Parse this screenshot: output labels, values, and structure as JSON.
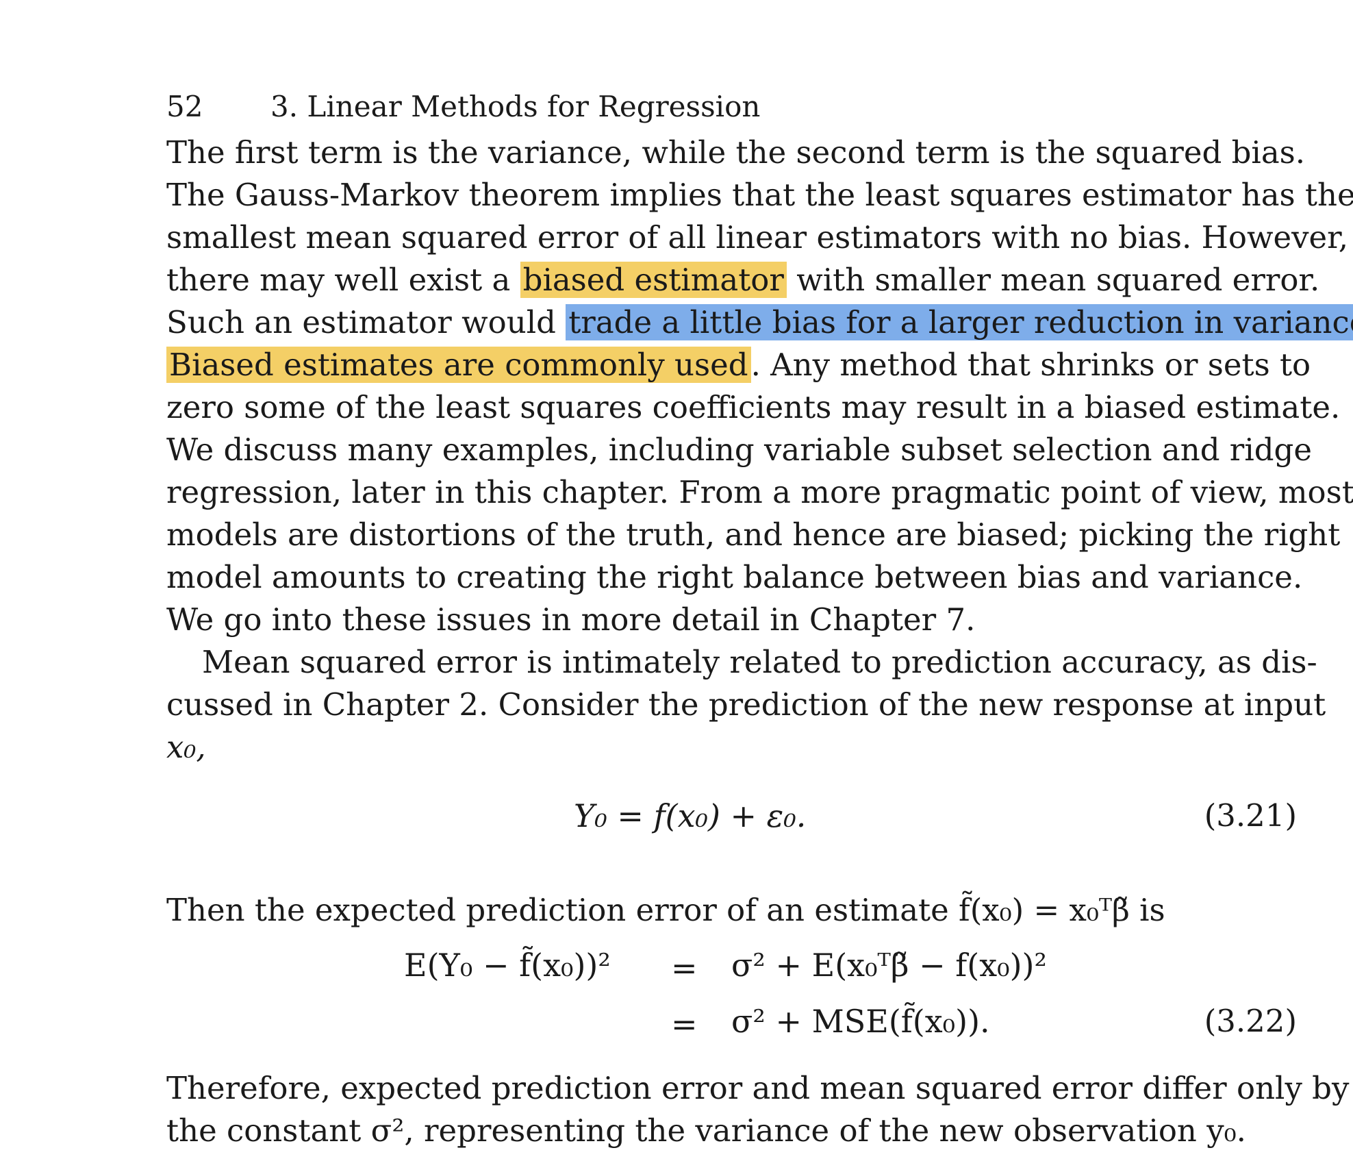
{
  "header": {
    "page_number": "52",
    "chapter_title": "3. Linear Methods for Regression"
  },
  "paragraph1": {
    "l1": "The first term is the variance, while the second term is the squared bias.",
    "l2": "The Gauss-Markov theorem implies that the least squares estimator has the",
    "l3": "smallest mean squared error of all linear estimators with no bias. However,",
    "l4_pre": "there may well exist a",
    "l4_hl": "biased estimator",
    "l4_post": "with smaller mean squared error.",
    "l5_pre": "Such an estimator would",
    "l5_hl": "trade a little bias for a larger reduction in variance",
    "l5_post": ".",
    "l6_hl": "Biased estimates are commonly used",
    "l6_post": ". Any method that shrinks or sets to",
    "l7": "zero some of the least squares coefficients may result in a biased estimate.",
    "l8": "We discuss many examples, including variable subset selection and ridge",
    "l9": "regression, later in this chapter. From a more pragmatic point of view, most",
    "l10": "models are distortions of the truth, and hence are biased; picking the right",
    "l11": "model amounts to creating the right balance between bias and variance.",
    "l12": "We go into these issues in more detail in Chapter 7."
  },
  "paragraph2": {
    "l1": "Mean squared error is intimately related to prediction accuracy, as dis-",
    "l2": "cussed in Chapter 2. Consider the prediction of the new response at input",
    "l3": "x₀,"
  },
  "equation_321": {
    "text": "Y₀ = f(x₀) + ε₀.",
    "number": "(3.21)"
  },
  "paragraph3": {
    "text": "Then the expected prediction error of an estimate f̃(x₀) = x₀ᵀβ̃ is"
  },
  "equation_322": {
    "lhs": "E(Y₀ − f̃(x₀))²",
    "eq1": "=",
    "rhs1": "σ² + E(x₀ᵀβ̃ − f(x₀))²",
    "eq2": "=",
    "rhs2": "σ² + MSE(f̃(x₀)).",
    "number": "(3.22)"
  },
  "paragraph4": {
    "l1": "Therefore, expected prediction error and mean squared error differ only by",
    "l2": "the constant σ², representing the variance of the new observation y₀."
  },
  "colors": {
    "highlight_yellow": "#f4cf66",
    "highlight_blue": "#7eadea"
  }
}
